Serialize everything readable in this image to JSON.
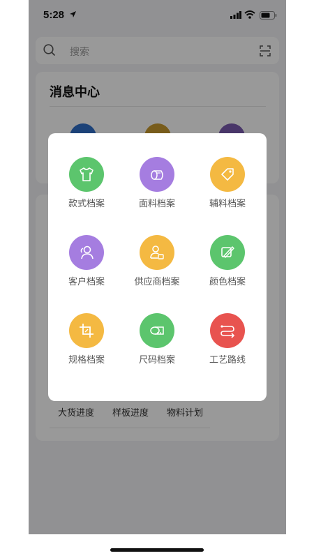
{
  "status_bar": {
    "time": "5:28"
  },
  "search": {
    "placeholder": "搜索"
  },
  "message_center": {
    "title": "消息中心",
    "icon_colors": [
      "#2f6fc9",
      "#c99a2e",
      "#7a5bb0"
    ]
  },
  "quick_links": [
    "大货进度",
    "样板进度",
    "物料计划"
  ],
  "archive_menu": {
    "items": [
      {
        "label": "款式档案",
        "icon": "tshirt-icon",
        "color": "#5cc56d"
      },
      {
        "label": "面料档案",
        "icon": "fabric-roll-icon",
        "color": "#a57de0"
      },
      {
        "label": "辅料档案",
        "icon": "tag-icon",
        "color": "#f4b942"
      },
      {
        "label": "客户档案",
        "icon": "customers-icon",
        "color": "#a57de0"
      },
      {
        "label": "供应商档案",
        "icon": "supplier-icon",
        "color": "#f4b942"
      },
      {
        "label": "颜色档案",
        "icon": "palette-icon",
        "color": "#5cc56d"
      },
      {
        "label": "规格档案",
        "icon": "crop-icon",
        "color": "#f4b942"
      },
      {
        "label": "尺码档案",
        "icon": "tape-measure-icon",
        "color": "#5cc56d"
      },
      {
        "label": "工艺路线",
        "icon": "route-icon",
        "color": "#e8534f"
      }
    ]
  }
}
